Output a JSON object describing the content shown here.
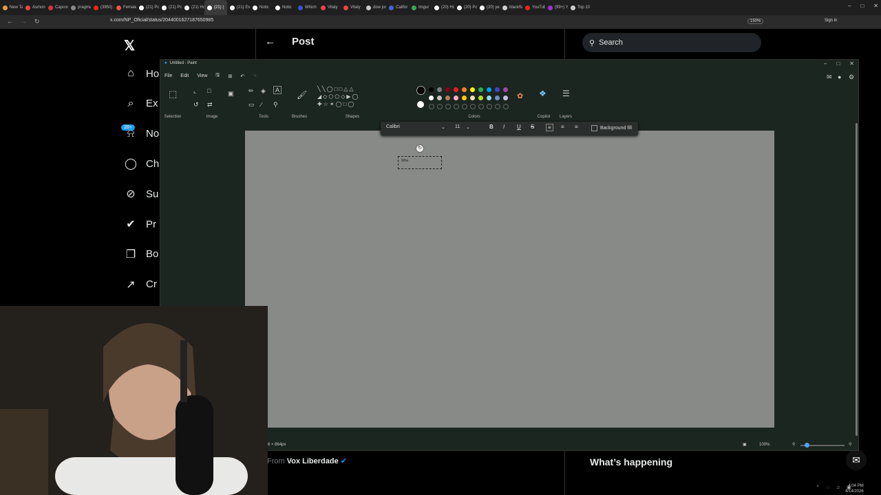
{
  "browser": {
    "tabs": [
      {
        "label": "New Tab",
        "color": "#e94"
      },
      {
        "label": "Asmon",
        "color": "#e44"
      },
      {
        "label": "Capcom",
        "color": "#d33"
      },
      {
        "label": "pragmat",
        "color": "#888"
      },
      {
        "label": "(3950) •",
        "color": "#e22"
      },
      {
        "label": "Female",
        "color": "#e54"
      },
      {
        "label": "(21) Po",
        "color": "#fff"
      },
      {
        "label": "(21) Po",
        "color": "#fff"
      },
      {
        "label": "(21) Ho",
        "color": "#fff"
      },
      {
        "label": "(21) |",
        "color": "#fff",
        "active": true
      },
      {
        "label": "(21) Exp",
        "color": "#fff"
      },
      {
        "label": "Notic",
        "color": "#fff"
      },
      {
        "label": "Notic",
        "color": "#fff"
      },
      {
        "label": "Which",
        "color": "#35c"
      },
      {
        "label": "Vitaly",
        "color": "#e44"
      },
      {
        "label": "Vitaly",
        "color": "#e44"
      },
      {
        "label": "dow jon",
        "color": "#ccc"
      },
      {
        "label": "Califor",
        "color": "#46c"
      },
      {
        "label": "Imgur",
        "color": "#3a5"
      },
      {
        "label": "(20) Ho",
        "color": "#fff"
      },
      {
        "label": "(20) Po",
        "color": "#fff"
      },
      {
        "label": "(20) yes",
        "color": "#fff"
      },
      {
        "label": "blackfla",
        "color": "#ccc"
      },
      {
        "label": "YouTub",
        "color": "#e22"
      },
      {
        "label": "(99+) Y",
        "color": "#93d"
      },
      {
        "label": "Top 10",
        "color": "#ccc"
      }
    ],
    "url": "x.com/NP_Oficial/status/2044001627187650985",
    "zoom_level": "150%",
    "sign_in": "Sign in"
  },
  "x_page": {
    "nav": [
      {
        "label": "Ho",
        "icon": "home-icon",
        "glyph": "⌂"
      },
      {
        "label": "Ex",
        "icon": "search-icon",
        "glyph": "⌕"
      },
      {
        "label": "No",
        "icon": "bell-icon",
        "glyph": "⍾"
      },
      {
        "label": "Ch",
        "icon": "chat-icon",
        "glyph": "◯"
      },
      {
        "label": "Su",
        "icon": "grok-icon",
        "glyph": "⊘"
      },
      {
        "label": "Pr",
        "icon": "verified-icon",
        "glyph": "✔"
      },
      {
        "label": "Bo",
        "icon": "bookmark-icon",
        "glyph": "❐"
      },
      {
        "label": "Cr",
        "icon": "rocket-icon",
        "glyph": "↗"
      }
    ],
    "notif_badge": "20+",
    "header_title": "Post",
    "search_placeholder": "Search",
    "from_prefix": "From",
    "from_name": "Vox Liberdade",
    "whats_happening": "What’s happening"
  },
  "paint": {
    "title": "Untitled - Paint",
    "menu": [
      "File",
      "Edit",
      "View"
    ],
    "groups": [
      "Selection",
      "Image",
      "Tools",
      "Brushes",
      "Shapes",
      "Colors",
      "Copilot",
      "Layers"
    ],
    "palette_row1": [
      "#000000",
      "#7f7f7f",
      "#880015",
      "#ed1c24",
      "#ff7f27",
      "#fff200",
      "#22b14c",
      "#00a2e8",
      "#3f48cc",
      "#a349a4"
    ],
    "palette_row2": [
      "#ffffff",
      "#c3c3c3",
      "#b97a57",
      "#ffaec9",
      "#ffc90e",
      "#efe4b0",
      "#b5e61d",
      "#99d9ea",
      "#7092be",
      "#c8bfe7"
    ],
    "font": "Calibri",
    "font_size": "11",
    "background_fill": "Background fill",
    "textbox_text": "Wha",
    "dimensions": "6 × 864px",
    "zoom": "100%"
  },
  "taskbar": {
    "time": "4:04 PM",
    "date": "4/14/2026"
  }
}
